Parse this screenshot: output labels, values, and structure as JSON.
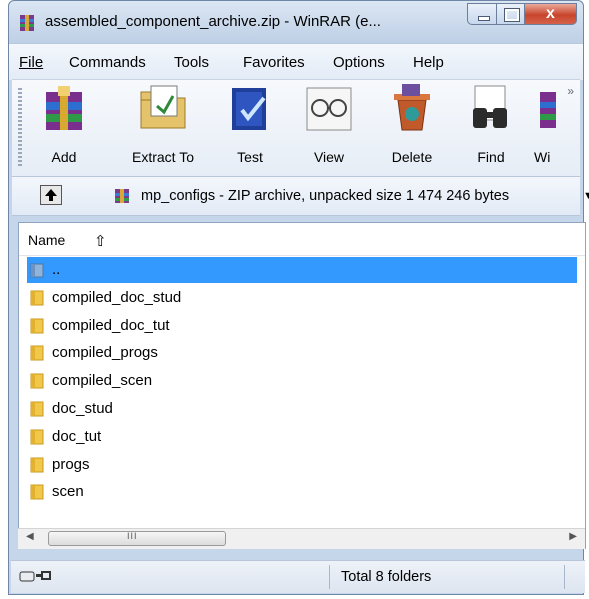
{
  "window": {
    "title": "assembled_component_archive.zip - WinRAR (e...",
    "close_glyph": "x"
  },
  "menu": [
    {
      "label": "File",
      "mnemonic": "F"
    },
    {
      "label": "Commands",
      "mnemonic": "C"
    },
    {
      "label": "Tools",
      "mnemonic": "s"
    },
    {
      "label": "Favorites",
      "mnemonic": "o"
    },
    {
      "label": "Options",
      "mnemonic": "n"
    },
    {
      "label": "Help",
      "mnemonic": "H"
    }
  ],
  "toolbar": {
    "buttons": [
      {
        "label": "Add",
        "icon": "add-archive-icon"
      },
      {
        "label": "Extract To",
        "icon": "extract-to-icon"
      },
      {
        "label": "Test",
        "icon": "test-icon"
      },
      {
        "label": "View",
        "icon": "view-icon"
      },
      {
        "label": "Delete",
        "icon": "delete-icon"
      },
      {
        "label": "Find",
        "icon": "find-icon"
      },
      {
        "label": "Wi",
        "icon": "wizard-icon"
      }
    ],
    "more_glyph": "»"
  },
  "address": {
    "text": "mp_configs - ZIP archive, unpacked size 1 474 246 bytes",
    "dropdown_glyph": "▼"
  },
  "list": {
    "column_name": "Name",
    "sort_glyph": "⇧",
    "rows": [
      {
        "label": "..",
        "selected": true,
        "icon": "parent-folder-icon"
      },
      {
        "label": "compiled_doc_stud",
        "icon": "folder-icon"
      },
      {
        "label": "compiled_doc_tut",
        "icon": "folder-icon"
      },
      {
        "label": "compiled_progs",
        "icon": "folder-icon"
      },
      {
        "label": "compiled_scen",
        "icon": "folder-icon"
      },
      {
        "label": "doc_stud",
        "icon": "folder-icon"
      },
      {
        "label": "doc_tut",
        "icon": "folder-icon"
      },
      {
        "label": "progs",
        "icon": "folder-icon"
      },
      {
        "label": "scen",
        "icon": "folder-icon"
      }
    ]
  },
  "scrollbar": {
    "left_glyph": "◀",
    "right_glyph": "▶",
    "thumb_grip": "III"
  },
  "status": {
    "text": "Total 8 folders"
  },
  "colors": {
    "selection": "#3399ff",
    "window_frame": "#c5d6ea",
    "close_button": "#c8452c"
  }
}
